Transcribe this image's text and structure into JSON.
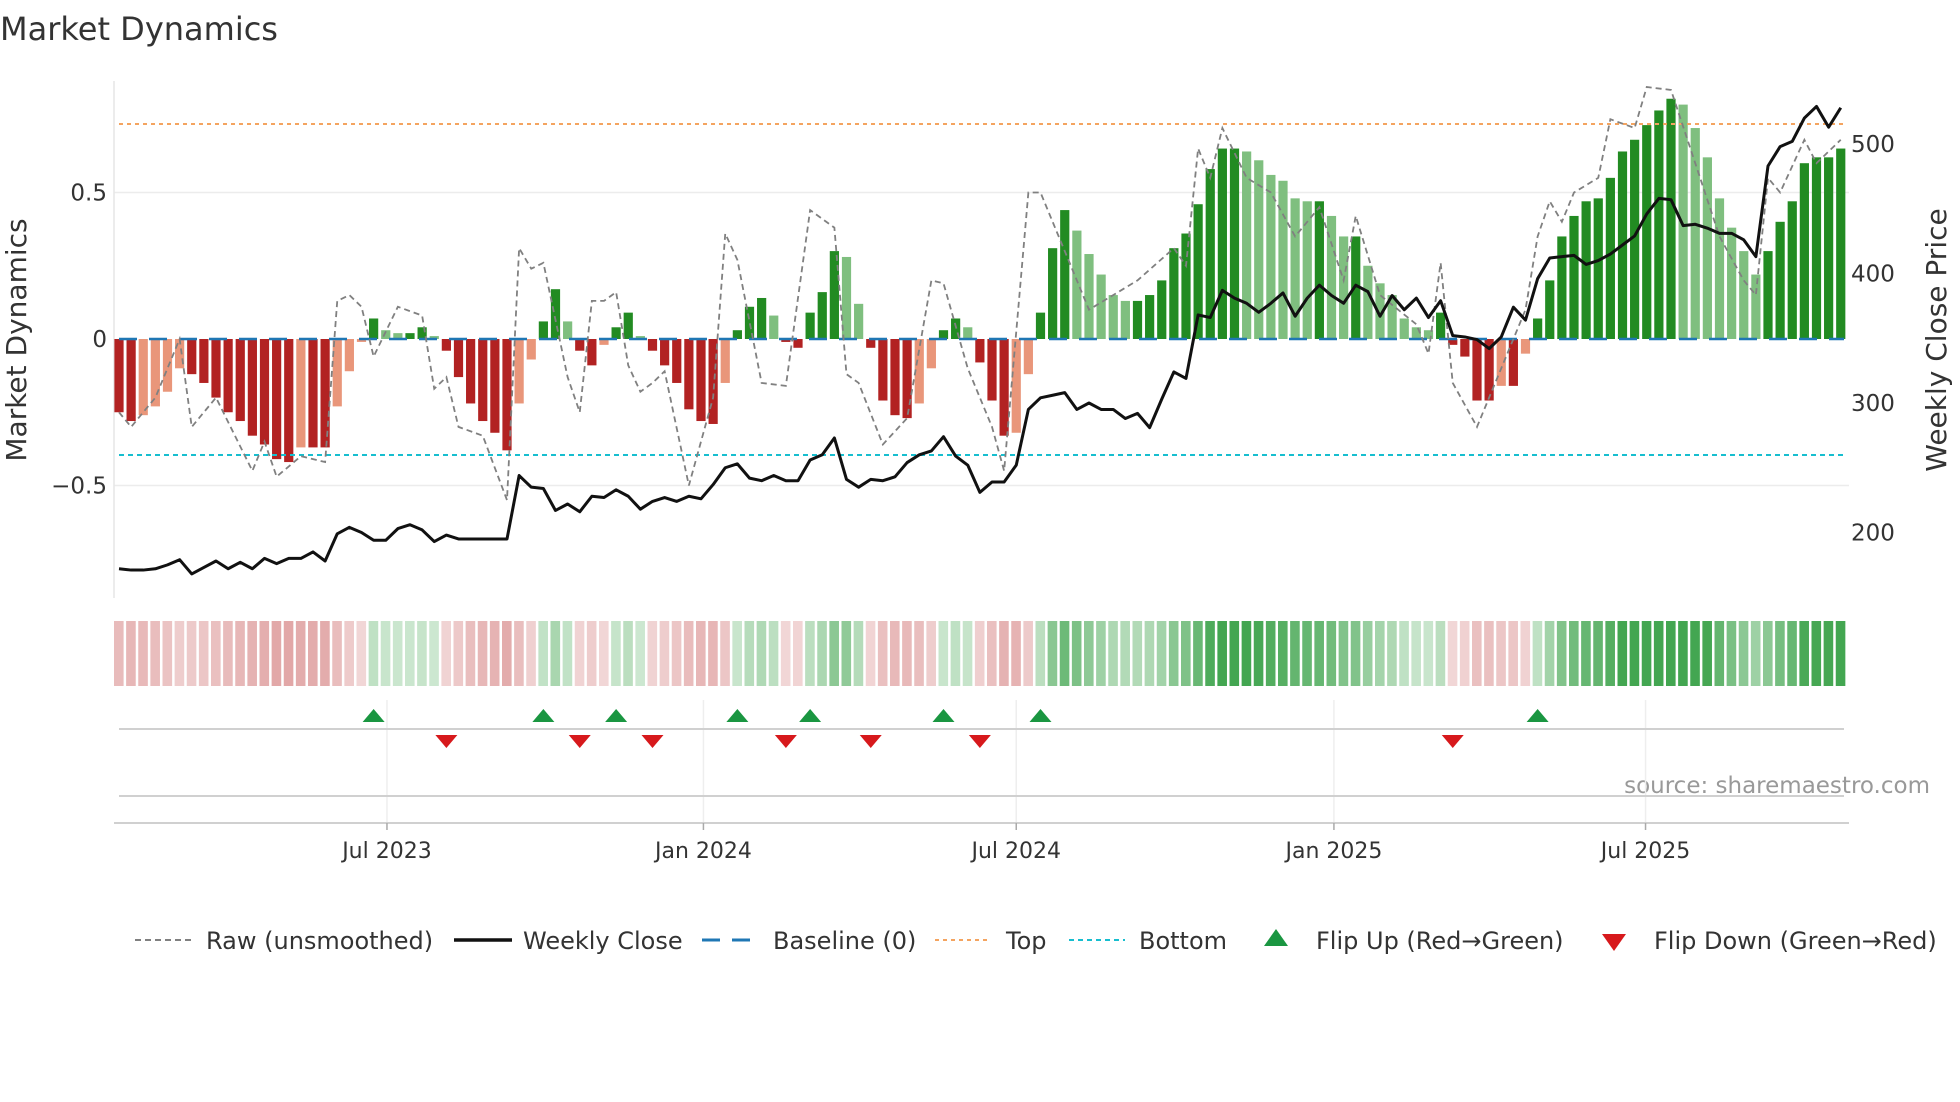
{
  "chart_data": {
    "type": "bar",
    "title": "Market Dynamics",
    "ylabel": "Market Dynamics",
    "y2label": "Weekly Close Price",
    "ylim": [
      -0.77,
      0.9
    ],
    "y2lim": [
      150,
      560
    ],
    "yticks": [
      {
        "v": 0.5,
        "label": "0.5"
      },
      {
        "v": 0,
        "label": "0"
      },
      {
        "v": -0.5,
        "label": "−0.5"
      }
    ],
    "y2ticks": [
      {
        "v": 500,
        "label": "500"
      },
      {
        "v": 400,
        "label": "400"
      },
      {
        "v": 300,
        "label": "300"
      },
      {
        "v": 200,
        "label": "200"
      }
    ],
    "xticks": [
      {
        "week": 22.1,
        "label": "Jul 2023"
      },
      {
        "week": 48.2,
        "label": "Jan 2024"
      },
      {
        "week": 74,
        "label": "Jul 2024"
      },
      {
        "week": 100.2,
        "label": "Jan 2025"
      },
      {
        "week": 125.9,
        "label": "Jul 2025"
      }
    ],
    "top_level": 0.734,
    "bottom_level": -0.396,
    "baseline": 0,
    "momentum": [
      -0.25,
      -0.28,
      -0.26,
      -0.23,
      -0.18,
      -0.1,
      -0.12,
      -0.15,
      -0.2,
      -0.25,
      -0.28,
      -0.33,
      -0.36,
      -0.41,
      -0.42,
      -0.37,
      -0.37,
      -0.37,
      -0.23,
      -0.11,
      -0.01,
      0.07,
      0.03,
      0.02,
      0.02,
      0.04,
      0.01,
      -0.04,
      -0.13,
      -0.22,
      -0.28,
      -0.32,
      -0.38,
      -0.22,
      -0.07,
      0.06,
      0.17,
      0.06,
      -0.04,
      -0.09,
      -0.02,
      0.04,
      0.09,
      0.01,
      -0.04,
      -0.09,
      -0.15,
      -0.24,
      -0.28,
      -0.29,
      -0.15,
      0.03,
      0.11,
      0.14,
      0.08,
      -0.01,
      -0.03,
      0.09,
      0.16,
      0.3,
      0.28,
      0.12,
      -0.03,
      -0.21,
      -0.26,
      -0.27,
      -0.22,
      -0.1,
      0.03,
      0.07,
      0.04,
      -0.08,
      -0.21,
      -0.33,
      -0.32,
      -0.12,
      0.09,
      0.31,
      0.44,
      0.37,
      0.29,
      0.22,
      0.15,
      0.13,
      0.13,
      0.15,
      0.2,
      0.31,
      0.36,
      0.46,
      0.58,
      0.65,
      0.65,
      0.64,
      0.61,
      0.56,
      0.54,
      0.48,
      0.47,
      0.47,
      0.42,
      0.35,
      0.35,
      0.25,
      0.19,
      0.15,
      0.07,
      0.04,
      0.03,
      0.09,
      -0.02,
      -0.06,
      -0.21,
      -0.21,
      -0.16,
      -0.16,
      -0.05,
      0.07,
      0.2,
      0.35,
      0.42,
      0.47,
      0.48,
      0.55,
      0.64,
      0.68,
      0.73,
      0.78,
      0.82,
      0.8,
      0.72,
      0.62,
      0.48,
      0.38,
      0.3,
      0.22,
      0.3,
      0.4,
      0.47,
      0.6,
      0.62,
      0.62,
      0.65
    ],
    "raw": [
      [
        0,
        -0.25
      ],
      [
        1,
        -0.3
      ],
      [
        3,
        -0.2
      ],
      [
        5,
        0.0
      ],
      [
        6,
        -0.3
      ],
      [
        8,
        -0.2
      ],
      [
        11,
        -0.45
      ],
      [
        12,
        -0.35
      ],
      [
        13,
        -0.47
      ],
      [
        15,
        -0.4
      ],
      [
        17,
        -0.42
      ],
      [
        18,
        0.13
      ],
      [
        19,
        0.15
      ],
      [
        20,
        0.11
      ],
      [
        21,
        -0.06
      ],
      [
        23,
        0.11
      ],
      [
        25,
        0.08
      ],
      [
        26,
        -0.17
      ],
      [
        27,
        -0.13
      ],
      [
        28,
        -0.3
      ],
      [
        30,
        -0.33
      ],
      [
        32,
        -0.55
      ],
      [
        33,
        0.31
      ],
      [
        34,
        0.24
      ],
      [
        35,
        0.26
      ],
      [
        37,
        -0.13
      ],
      [
        38,
        -0.25
      ],
      [
        39,
        0.13
      ],
      [
        40,
        0.13
      ],
      [
        41,
        0.16
      ],
      [
        42,
        -0.09
      ],
      [
        43,
        -0.18
      ],
      [
        44,
        -0.15
      ],
      [
        45,
        -0.11
      ],
      [
        47,
        -0.5
      ],
      [
        49,
        -0.2
      ],
      [
        50,
        0.36
      ],
      [
        51,
        0.27
      ],
      [
        53,
        -0.15
      ],
      [
        55,
        -0.16
      ],
      [
        57,
        0.44
      ],
      [
        59,
        0.38
      ],
      [
        60,
        -0.12
      ],
      [
        61,
        -0.15
      ],
      [
        63,
        -0.36
      ],
      [
        65,
        -0.27
      ],
      [
        67,
        0.2
      ],
      [
        68,
        0.19
      ],
      [
        70,
        -0.1
      ],
      [
        72,
        -0.3
      ],
      [
        73,
        -0.45
      ],
      [
        75,
        0.5
      ],
      [
        76,
        0.5
      ],
      [
        78,
        0.3
      ],
      [
        80,
        0.1
      ],
      [
        84,
        0.2
      ],
      [
        87,
        0.31
      ],
      [
        88,
        0.25
      ],
      [
        89,
        0.65
      ],
      [
        90,
        0.55
      ],
      [
        91,
        0.72
      ],
      [
        93,
        0.55
      ],
      [
        95,
        0.5
      ],
      [
        97,
        0.35
      ],
      [
        99,
        0.45
      ],
      [
        101,
        0.2
      ],
      [
        102,
        0.42
      ],
      [
        104,
        0.15
      ],
      [
        107,
        0.05
      ],
      [
        108,
        -0.05
      ],
      [
        109,
        0.26
      ],
      [
        110,
        -0.15
      ],
      [
        112,
        -0.3
      ],
      [
        114,
        -0.1
      ],
      [
        116,
        0.1
      ],
      [
        117,
        0.35
      ],
      [
        118,
        0.47
      ],
      [
        119,
        0.4
      ],
      [
        120,
        0.5
      ],
      [
        122,
        0.55
      ],
      [
        123,
        0.75
      ],
      [
        125,
        0.72
      ],
      [
        126,
        0.86
      ],
      [
        128,
        0.85
      ],
      [
        130,
        0.6
      ],
      [
        132,
        0.35
      ],
      [
        134,
        0.2
      ],
      [
        135,
        0.15
      ],
      [
        136,
        0.55
      ],
      [
        137,
        0.5
      ],
      [
        139,
        0.68
      ],
      [
        140,
        0.6
      ],
      [
        142,
        0.68
      ]
    ],
    "close": [
      172,
      171,
      171,
      172,
      175,
      179,
      168,
      173,
      178,
      172,
      177,
      172,
      180,
      176,
      180,
      180,
      185,
      178,
      199,
      204,
      200,
      194,
      194,
      203,
      206,
      202,
      193,
      198,
      195,
      195,
      195,
      195,
      195,
      244,
      235,
      234,
      217,
      222,
      216,
      228,
      227,
      233,
      228,
      218,
      224,
      227,
      224,
      228,
      226,
      237,
      250,
      253,
      242,
      240,
      244,
      240,
      240,
      256,
      260,
      273,
      241,
      235,
      241,
      240,
      243,
      254,
      260,
      263,
      274,
      259,
      252,
      231,
      239,
      239,
      252,
      295,
      304,
      306,
      308,
      295,
      300,
      295,
      295,
      288,
      292,
      281,
      303,
      324,
      319,
      368,
      366,
      387,
      381,
      377,
      370,
      377,
      385,
      367,
      381,
      391,
      383,
      377,
      391,
      386,
      367,
      383,
      372,
      381,
      366,
      379,
      352,
      351,
      349,
      342,
      351,
      374,
      364,
      396,
      412,
      413,
      414,
      407,
      410,
      415,
      422,
      429,
      446,
      458,
      457,
      437,
      438,
      435,
      431,
      431,
      426,
      413,
      483,
      498,
      502,
      520,
      529,
      513,
      528
    ],
    "flip_up_weeks": [
      21,
      35,
      41,
      51,
      57,
      68,
      76,
      117
    ],
    "flip_down_weeks": [
      27,
      38,
      44,
      55,
      62,
      71,
      110
    ],
    "source": "source: sharemaestro.com",
    "legend": [
      {
        "label": "Raw (unsmoothed)",
        "kind": "raw"
      },
      {
        "label": "Weekly Close",
        "kind": "close"
      },
      {
        "label": "Baseline (0)",
        "kind": "baseline"
      },
      {
        "label": "Top",
        "kind": "top"
      },
      {
        "label": "Bottom",
        "kind": "bottom"
      },
      {
        "label": "Flip Up (Red→Green)",
        "kind": "up"
      },
      {
        "label": "Flip Down (Green→Red)",
        "kind": "down"
      }
    ],
    "colors": {
      "strong_green": "#228b22",
      "weak_green": "#7fbf7f",
      "strong_red": "#b22222",
      "weak_red": "#e9967a",
      "baseline": "#1f77b4",
      "top": "#f4a460",
      "bottom": "#17becf",
      "flip_up": "#1a9641",
      "flip_down": "#d7191c",
      "close": "#111111",
      "raw": "#808080"
    }
  }
}
